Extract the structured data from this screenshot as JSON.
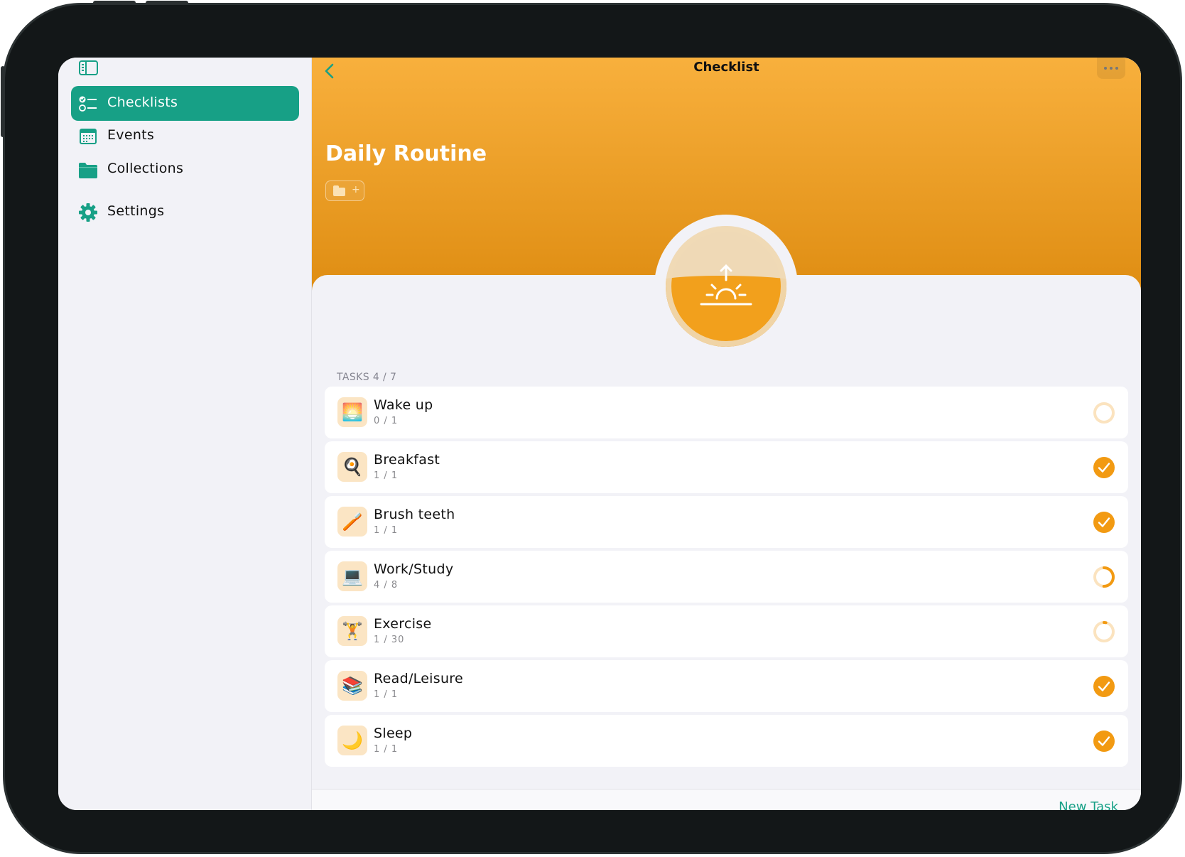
{
  "sidebar": {
    "items": [
      {
        "label": "Checklists",
        "icon": "checklist-icon",
        "active": true
      },
      {
        "label": "Events",
        "icon": "calendar-icon",
        "active": false
      },
      {
        "label": "Collections",
        "icon": "folder-icon",
        "active": false
      },
      {
        "label": "Settings",
        "icon": "gear-icon",
        "active": false
      }
    ]
  },
  "nav": {
    "title": "Checklist",
    "back_icon": "chevron-left-icon",
    "more_icon": "ellipsis-icon"
  },
  "checklist": {
    "title": "Daily Routine",
    "collection_chip_plus": "+",
    "hero_icon": "sunrise-icon"
  },
  "tasks_header": "TASKS 4 / 7",
  "tasks": [
    {
      "name": "Wake up",
      "count": "0 / 1",
      "emoji": "🌅",
      "progress": 0.0
    },
    {
      "name": "Breakfast",
      "count": "1 / 1",
      "emoji": "🍳",
      "progress": 1.0
    },
    {
      "name": "Brush teeth",
      "count": "1 / 1",
      "emoji": "🪥",
      "progress": 1.0
    },
    {
      "name": "Work/Study",
      "count": "4 / 8",
      "emoji": "💻",
      "progress": 0.5
    },
    {
      "name": "Exercise",
      "count": "1 / 30",
      "emoji": "🏋",
      "progress": 0.0333
    },
    {
      "name": "Read/Leisure",
      "count": "1 / 1",
      "emoji": "📚",
      "progress": 1.0
    },
    {
      "name": "Sleep",
      "count": "1 / 1",
      "emoji": "🌙",
      "progress": 1.0
    }
  ],
  "bottom": {
    "new_task_label": "New Task"
  },
  "colors": {
    "accent": "#17a086",
    "header_top": "#f8b03d",
    "header_bottom": "#de8c11",
    "progress": "#f29a12",
    "progress_track": "#fbe3bf"
  }
}
